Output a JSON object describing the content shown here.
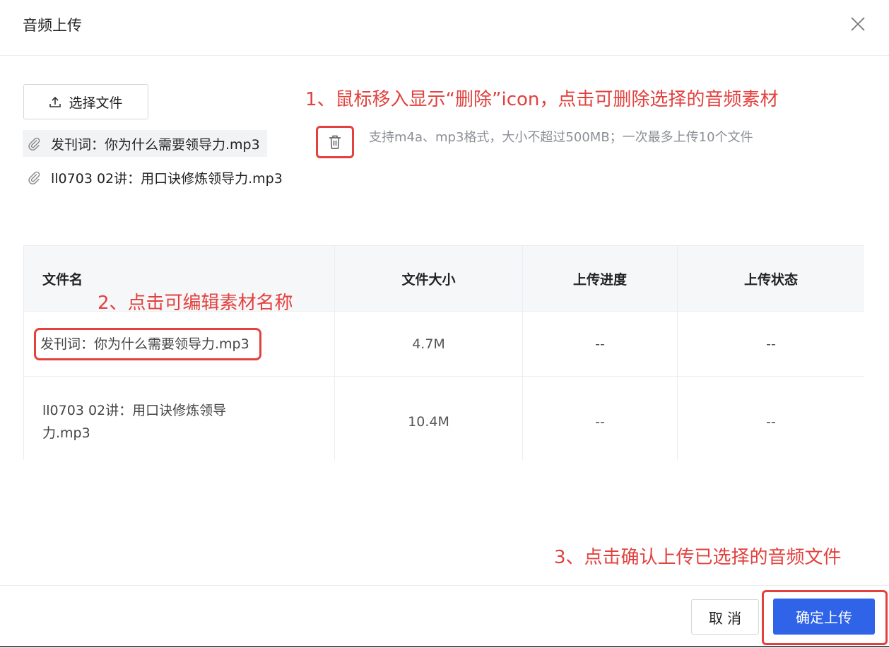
{
  "dialog": {
    "title": "音频上传",
    "close_icon": "close-x-icon"
  },
  "upload": {
    "select_label": "选择文件",
    "select_icon": "upload-icon",
    "tip": "支持m4a、mp3格式，大小不超过500MB；一次最多上传10个文件",
    "files": [
      {
        "name": "发刊词：你为什么需要领导力.mp3",
        "icon": "paperclip-icon"
      },
      {
        "name": "ll0703 02讲：用口诀修炼领导力.mp3",
        "icon": "paperclip-icon"
      }
    ],
    "delete_icon": "trash-icon"
  },
  "annotations": {
    "a1": "1、鼠标移入显示“删除”icon，点击可删除选择的音频素材",
    "a2": "2、点击可编辑素材名称",
    "a3": "3、点击确认上传已选择的音频文件"
  },
  "table": {
    "headers": [
      "文件名",
      "文件大小",
      "上传进度",
      "上传状态"
    ],
    "rows": [
      {
        "name": "发刊词：你为什么需要领导力.mp3",
        "size": "4.7M",
        "progress": "--",
        "status": "--"
      },
      {
        "name": "ll0703 02讲：用口诀修炼领导力.mp3",
        "size": "10.4M",
        "progress": "--",
        "status": "--"
      }
    ]
  },
  "footer": {
    "cancel_label": "取 消",
    "confirm_label": "确定上传"
  },
  "colors": {
    "primary": "#2f63e8",
    "annotation": "#e2413e",
    "border": "#ebedf0",
    "header_bg": "#f6f7f9"
  }
}
